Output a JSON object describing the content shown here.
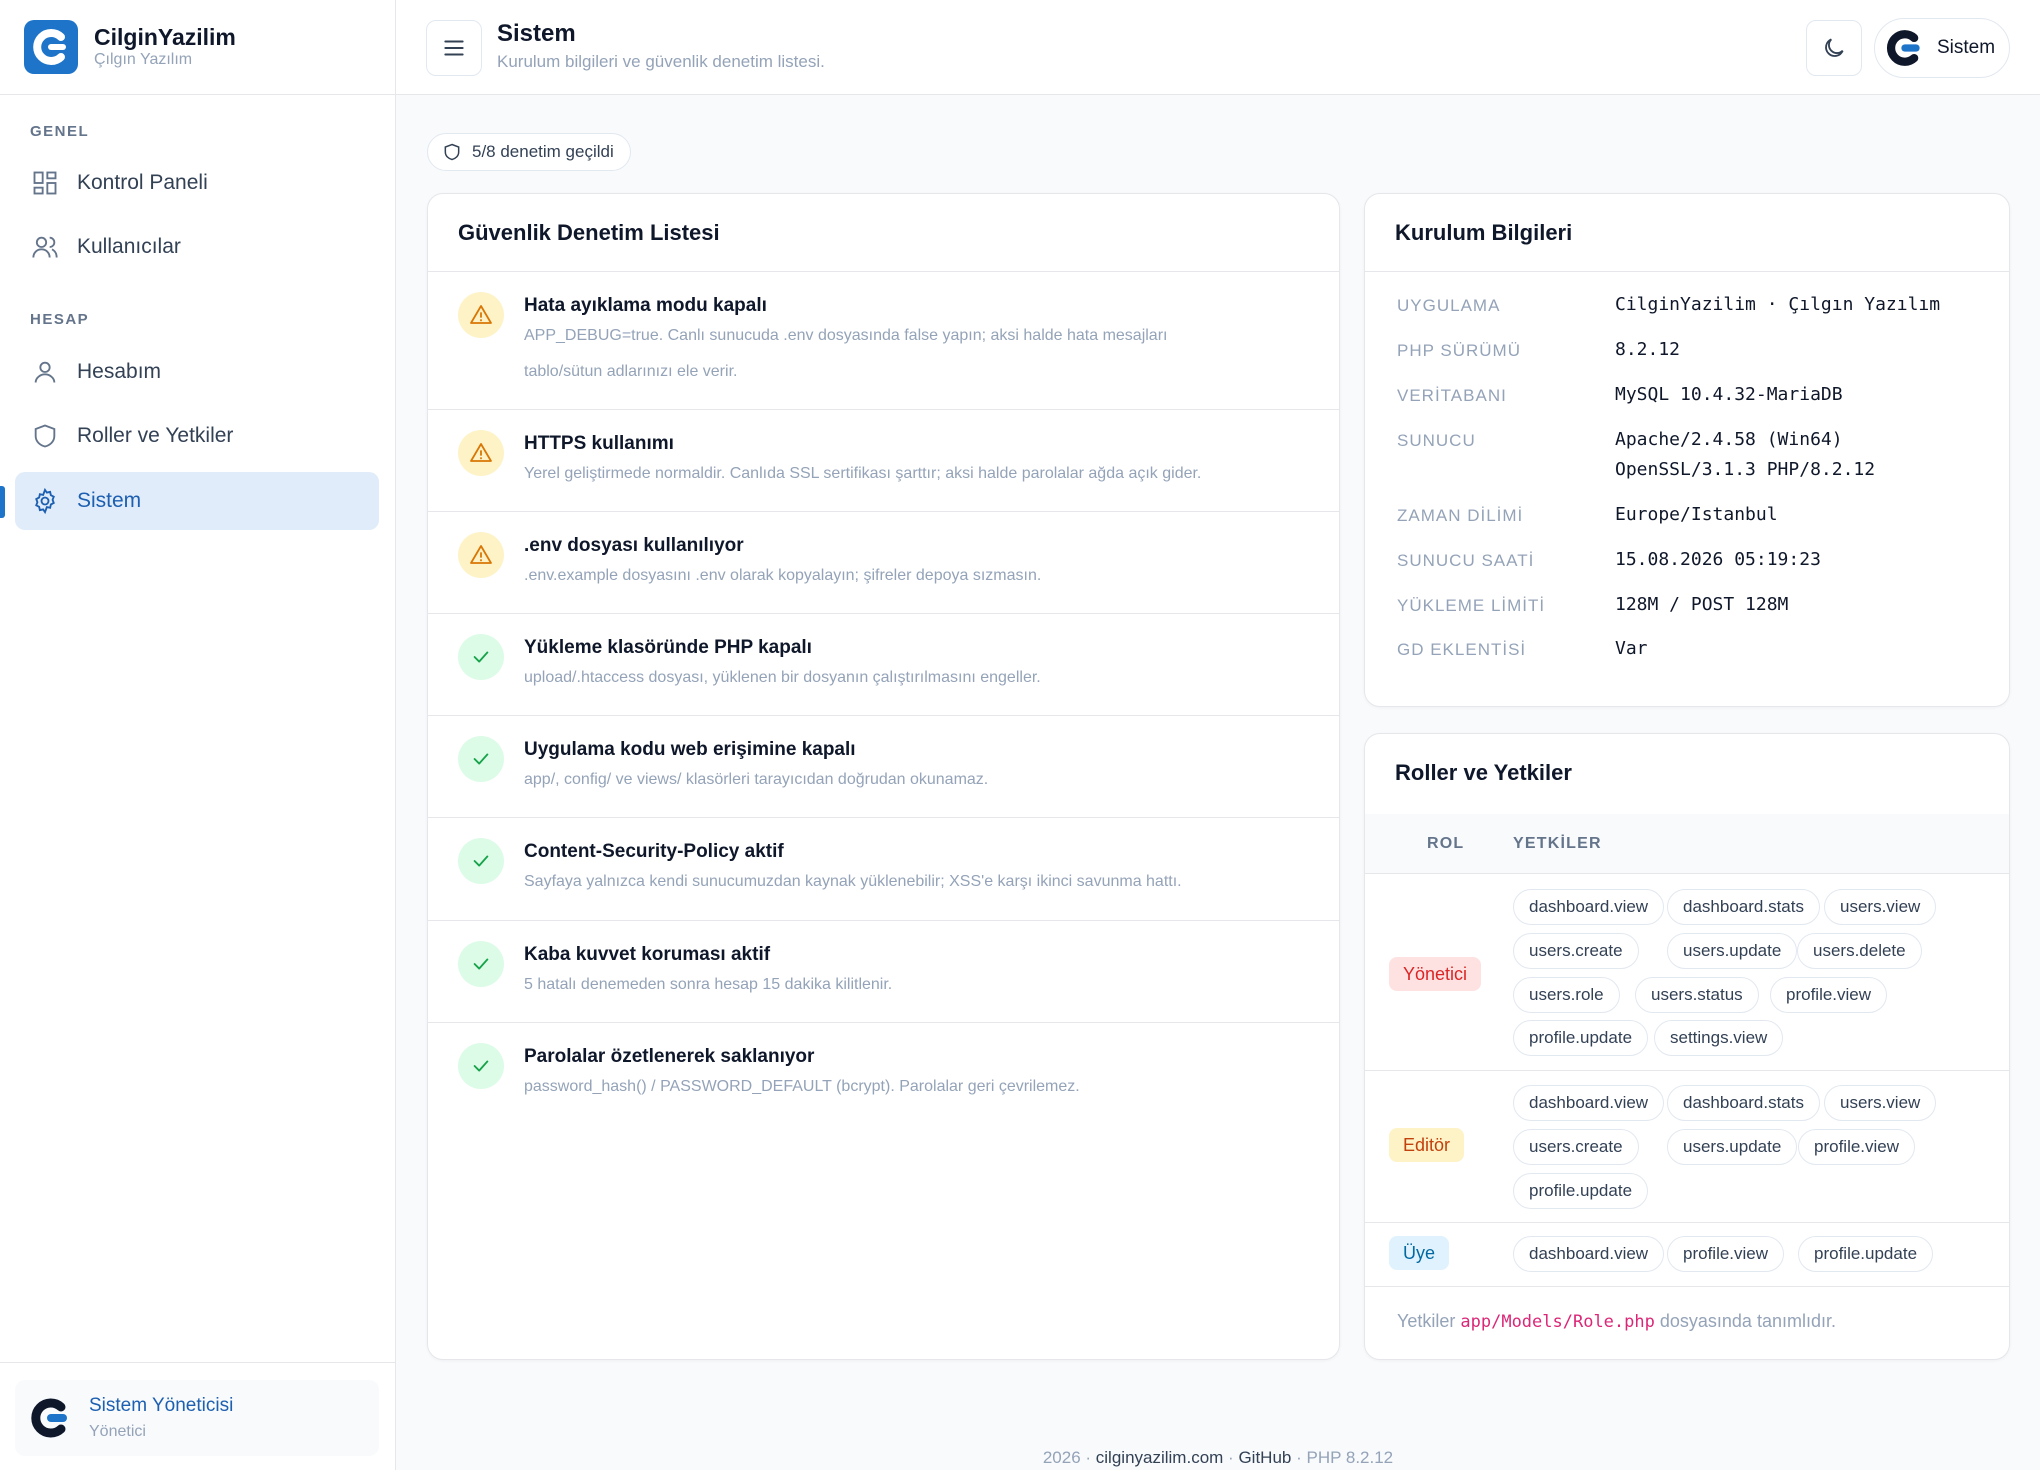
{
  "brand": {
    "name": "CilginYazilim",
    "subtitle": "Çılgın Yazılım"
  },
  "sidebar": {
    "sections": [
      {
        "title": "GENEL",
        "items": [
          {
            "label": "Kontrol Paneli",
            "icon": "dashboard-icon"
          },
          {
            "label": "Kullanıcılar",
            "icon": "users-icon"
          }
        ]
      },
      {
        "title": "HESAP",
        "items": [
          {
            "label": "Hesabım",
            "icon": "user-icon"
          },
          {
            "label": "Roller ve Yetkiler",
            "icon": "shield-icon"
          },
          {
            "label": "Sistem",
            "icon": "gear-icon",
            "active": true
          }
        ]
      }
    ],
    "user": {
      "name": "Sistem Yöneticisi",
      "role": "Yönetici"
    }
  },
  "header": {
    "title": "Sistem",
    "subtitle": "Kurulum bilgileri ve güvenlik denetim listesi.",
    "profile_label": "Sistem"
  },
  "badge": {
    "text": "5/8 denetim geçildi"
  },
  "audit": {
    "title": "Güvenlik Denetim Listesi",
    "items": [
      {
        "status": "warn",
        "title": "Hata ayıklama modu kapalı",
        "desc": "APP_DEBUG=true. Canlı sunucuda .env dosyasında false yapın; aksi halde hata mesajları tablo/sütun adlarınızı ele verir."
      },
      {
        "status": "warn",
        "title": "HTTPS kullanımı",
        "desc": "Yerel geliştirmede normaldir. Canlıda SSL sertifikası şarttır; aksi halde parolalar ağda açık gider."
      },
      {
        "status": "warn",
        "title": ".env dosyası kullanılıyor",
        "desc": ".env.example dosyasını .env olarak kopyalayın; şifreler depoya sızmasın."
      },
      {
        "status": "ok",
        "title": "Yükleme klasöründe PHP kapalı",
        "desc": "upload/.htaccess dosyası, yüklenen bir dosyanın çalıştırılmasını engeller."
      },
      {
        "status": "ok",
        "title": "Uygulama kodu web erişimine kapalı",
        "desc": "app/, config/ ve views/ klasörleri tarayıcıdan doğrudan okunamaz."
      },
      {
        "status": "ok",
        "title": "Content-Security-Policy aktif",
        "desc": "Sayfaya yalnızca kendi sunucumuzdan kaynak yüklenebilir; XSS'e karşı ikinci savunma hattı."
      },
      {
        "status": "ok",
        "title": "Kaba kuvvet koruması aktif",
        "desc": "5 hatalı denemeden sonra hesap 15 dakika kilitlenir."
      },
      {
        "status": "ok",
        "title": "Parolalar özetlenerek saklanıyor",
        "desc": "password_hash() / PASSWORD_DEFAULT (bcrypt). Parolalar geri çevrilemez."
      }
    ]
  },
  "install": {
    "title": "Kurulum Bilgileri",
    "rows": [
      {
        "key": "UYGULAMA",
        "value": "CilginYazilim · Çılgın Yazılım"
      },
      {
        "key": "PHP SÜRÜMÜ",
        "value": "8.2.12"
      },
      {
        "key": "VERİTABANI",
        "value": "MySQL 10.4.32-MariaDB"
      },
      {
        "key": "SUNUCU",
        "value": "Apache/2.4.58 (Win64)",
        "value2": "OpenSSL/3.1.3 PHP/8.2.12"
      },
      {
        "key": "ZAMAN DİLİMİ",
        "value": "Europe/Istanbul"
      },
      {
        "key": "SUNUCU SAATİ",
        "value": "15.08.2026 05:19:23"
      },
      {
        "key": "YÜKLEME LİMİTİ",
        "value": "128M / POST 128M"
      },
      {
        "key": "GD EKLENTİSİ",
        "value": "Var"
      }
    ]
  },
  "roles": {
    "title": "Roller ve Yetkiler",
    "col_role": "ROL",
    "col_perms": "YETKİLER",
    "rows": [
      {
        "role": "Yönetici",
        "color": "#dc2626",
        "bg": "#fee2e2",
        "perms": [
          "dashboard.view",
          "dashboard.stats",
          "users.view",
          "users.create",
          "users.update",
          "users.delete",
          "users.role",
          "users.status",
          "profile.view",
          "profile.update",
          "settings.view"
        ]
      },
      {
        "role": "Editör",
        "color": "#c2410c",
        "bg": "#fef3c7",
        "perms": [
          "dashboard.view",
          "dashboard.stats",
          "users.view",
          "users.create",
          "users.update",
          "profile.view",
          "profile.update"
        ]
      },
      {
        "role": "Üye",
        "color": "#0369a1",
        "bg": "#e0f2fe",
        "perms": [
          "dashboard.view",
          "profile.view",
          "profile.update"
        ]
      }
    ],
    "footer_pre": "Yetkiler",
    "footer_code": "app/Models/Role.php",
    "footer_post": "dosyasında tanımlıdır."
  },
  "footer": {
    "year": "2026 ·",
    "site": "cilginyazilim.com",
    "sep": "·",
    "github": "GitHub",
    "php": "· PHP 8.2.12"
  },
  "colors": {
    "accent": "#1d74c9",
    "warn": "#d97706",
    "ok": "#16a34a"
  }
}
